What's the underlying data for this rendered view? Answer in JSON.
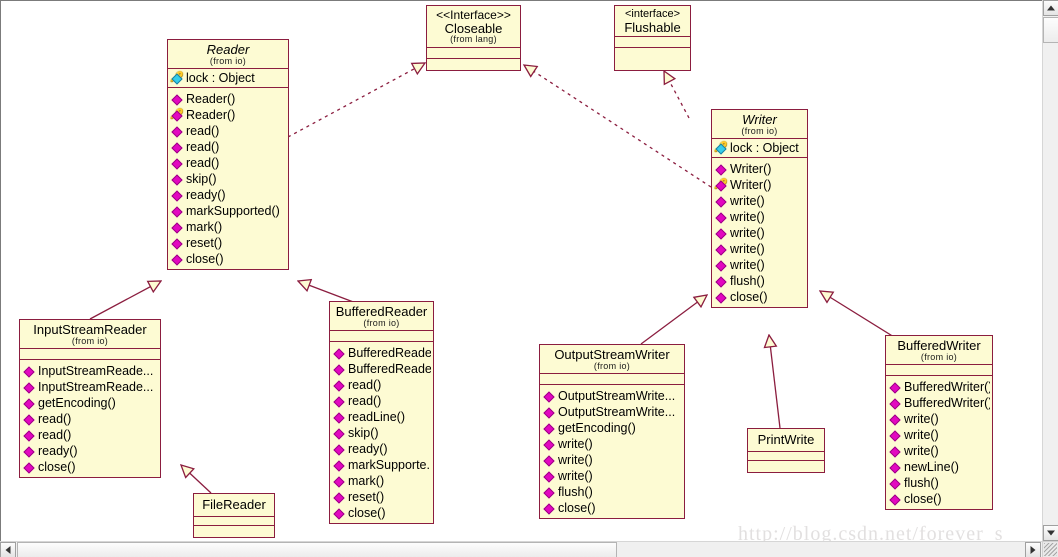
{
  "watermark": "http://blog.csdn.net/forever_s",
  "colors": {
    "class_fill": "#fdfbd3",
    "class_border": "#8b1d3f",
    "edge": "#8b1d3f",
    "member_public": "#e307c0",
    "member_attribute": "#34cdea",
    "watermark_text": "#e2e0e0"
  },
  "classes": {
    "closeable": {
      "stereotype": "<<Interface>>",
      "name": "Closeable",
      "package": "(from lang)",
      "attributes": [],
      "operations": []
    },
    "flushable": {
      "stereotype": "<interface>",
      "name": "Flushable",
      "package": "",
      "attributes": [],
      "operations": []
    },
    "reader": {
      "name": "Reader",
      "package": "(from io)",
      "attributes": [
        {
          "label": "lock : Object",
          "icon": "key-attribute-icon",
          "marker": "cyan",
          "key": true
        }
      ],
      "operations": [
        {
          "label": "Reader()",
          "icon": "public-member-icon",
          "key": false
        },
        {
          "label": "Reader()",
          "icon": "protected-member-icon",
          "key": true
        },
        {
          "label": "read()",
          "icon": "public-member-icon",
          "key": false
        },
        {
          "label": "read()",
          "icon": "public-member-icon",
          "key": false
        },
        {
          "label": "read()",
          "icon": "public-member-icon",
          "key": false
        },
        {
          "label": "skip()",
          "icon": "public-member-icon",
          "key": false
        },
        {
          "label": "ready()",
          "icon": "public-member-icon",
          "key": false
        },
        {
          "label": "markSupported()",
          "icon": "public-member-icon",
          "key": false
        },
        {
          "label": "mark()",
          "icon": "public-member-icon",
          "key": false
        },
        {
          "label": "reset()",
          "icon": "public-member-icon",
          "key": false
        },
        {
          "label": "close()",
          "icon": "public-member-icon",
          "key": false
        }
      ]
    },
    "writer": {
      "name": "Writer",
      "package": "(from io)",
      "attributes": [
        {
          "label": "lock : Object",
          "icon": "key-attribute-icon",
          "marker": "cyan",
          "key": true
        }
      ],
      "operations": [
        {
          "label": "Writer()",
          "icon": "public-member-icon",
          "key": false
        },
        {
          "label": "Writer()",
          "icon": "protected-member-icon",
          "key": true
        },
        {
          "label": "write()",
          "icon": "public-member-icon",
          "key": false
        },
        {
          "label": "write()",
          "icon": "public-member-icon",
          "key": false
        },
        {
          "label": "write()",
          "icon": "public-member-icon",
          "key": false
        },
        {
          "label": "write()",
          "icon": "public-member-icon",
          "key": false
        },
        {
          "label": "write()",
          "icon": "public-member-icon",
          "key": false
        },
        {
          "label": "flush()",
          "icon": "public-member-icon",
          "key": false
        },
        {
          "label": "close()",
          "icon": "public-member-icon",
          "key": false
        }
      ]
    },
    "input_stream_reader": {
      "name": "InputStreamReader",
      "package": "(from io)",
      "attributes": [],
      "operations": [
        {
          "label": "InputStreamReade...",
          "icon": "public-member-icon",
          "key": false
        },
        {
          "label": "InputStreamReade...",
          "icon": "public-member-icon",
          "key": false
        },
        {
          "label": "getEncoding()",
          "icon": "public-member-icon",
          "key": false
        },
        {
          "label": "read()",
          "icon": "public-member-icon",
          "key": false
        },
        {
          "label": "read()",
          "icon": "public-member-icon",
          "key": false
        },
        {
          "label": "ready()",
          "icon": "public-member-icon",
          "key": false
        },
        {
          "label": "close()",
          "icon": "public-member-icon",
          "key": false
        }
      ]
    },
    "buffered_reader": {
      "name": "BufferedReader",
      "package": "(from io)",
      "attributes": [],
      "operations": [
        {
          "label": "BufferedReade...",
          "icon": "public-member-icon",
          "key": false
        },
        {
          "label": "BufferedReade...",
          "icon": "public-member-icon",
          "key": false
        },
        {
          "label": "read()",
          "icon": "public-member-icon",
          "key": false
        },
        {
          "label": "read()",
          "icon": "public-member-icon",
          "key": false
        },
        {
          "label": "readLine()",
          "icon": "public-member-icon",
          "key": false
        },
        {
          "label": "skip()",
          "icon": "public-member-icon",
          "key": false
        },
        {
          "label": "ready()",
          "icon": "public-member-icon",
          "key": false
        },
        {
          "label": "markSupporte...",
          "icon": "public-member-icon",
          "key": false
        },
        {
          "label": "mark()",
          "icon": "public-member-icon",
          "key": false
        },
        {
          "label": "reset()",
          "icon": "public-member-icon",
          "key": false
        },
        {
          "label": "close()",
          "icon": "public-member-icon",
          "key": false
        }
      ]
    },
    "file_reader": {
      "name": "FileReader",
      "package": "",
      "attributes": [],
      "operations": []
    },
    "output_stream_writer": {
      "name": "OutputStreamWriter",
      "package": "(from io)",
      "attributes": [],
      "operations": [
        {
          "label": "OutputStreamWrite...",
          "icon": "public-member-icon",
          "key": false
        },
        {
          "label": "OutputStreamWrite...",
          "icon": "public-member-icon",
          "key": false
        },
        {
          "label": "getEncoding()",
          "icon": "public-member-icon",
          "key": false
        },
        {
          "label": "write()",
          "icon": "public-member-icon",
          "key": false
        },
        {
          "label": "write()",
          "icon": "public-member-icon",
          "key": false
        },
        {
          "label": "write()",
          "icon": "public-member-icon",
          "key": false
        },
        {
          "label": "flush()",
          "icon": "public-member-icon",
          "key": false
        },
        {
          "label": "close()",
          "icon": "public-member-icon",
          "key": false
        }
      ]
    },
    "buffered_writer": {
      "name": "BufferedWriter",
      "package": "(from io)",
      "attributes": [],
      "operations": [
        {
          "label": "BufferedWriter()",
          "icon": "public-member-icon",
          "key": false
        },
        {
          "label": "BufferedWriter()",
          "icon": "public-member-icon",
          "key": false
        },
        {
          "label": "write()",
          "icon": "public-member-icon",
          "key": false
        },
        {
          "label": "write()",
          "icon": "public-member-icon",
          "key": false
        },
        {
          "label": "write()",
          "icon": "public-member-icon",
          "key": false
        },
        {
          "label": "newLine()",
          "icon": "public-member-icon",
          "key": false
        },
        {
          "label": "flush()",
          "icon": "public-member-icon",
          "key": false
        },
        {
          "label": "close()",
          "icon": "public-member-icon",
          "key": false
        }
      ]
    },
    "print_write": {
      "name": "PrintWrite",
      "package": "",
      "attributes": [],
      "operations": []
    }
  },
  "relationships": [
    {
      "from": "Reader",
      "to": "Closeable",
      "type": "realization"
    },
    {
      "from": "Writer",
      "to": "Closeable",
      "type": "realization"
    },
    {
      "from": "Writer",
      "to": "Flushable",
      "type": "realization"
    },
    {
      "from": "InputStreamReader",
      "to": "Reader",
      "type": "generalization"
    },
    {
      "from": "BufferedReader",
      "to": "Reader",
      "type": "generalization"
    },
    {
      "from": "FileReader",
      "to": "InputStreamReader",
      "type": "generalization"
    },
    {
      "from": "OutputStreamWriter",
      "to": "Writer",
      "type": "generalization"
    },
    {
      "from": "BufferedWriter",
      "to": "Writer",
      "type": "generalization"
    },
    {
      "from": "PrintWrite",
      "to": "Writer",
      "type": "generalization"
    }
  ]
}
